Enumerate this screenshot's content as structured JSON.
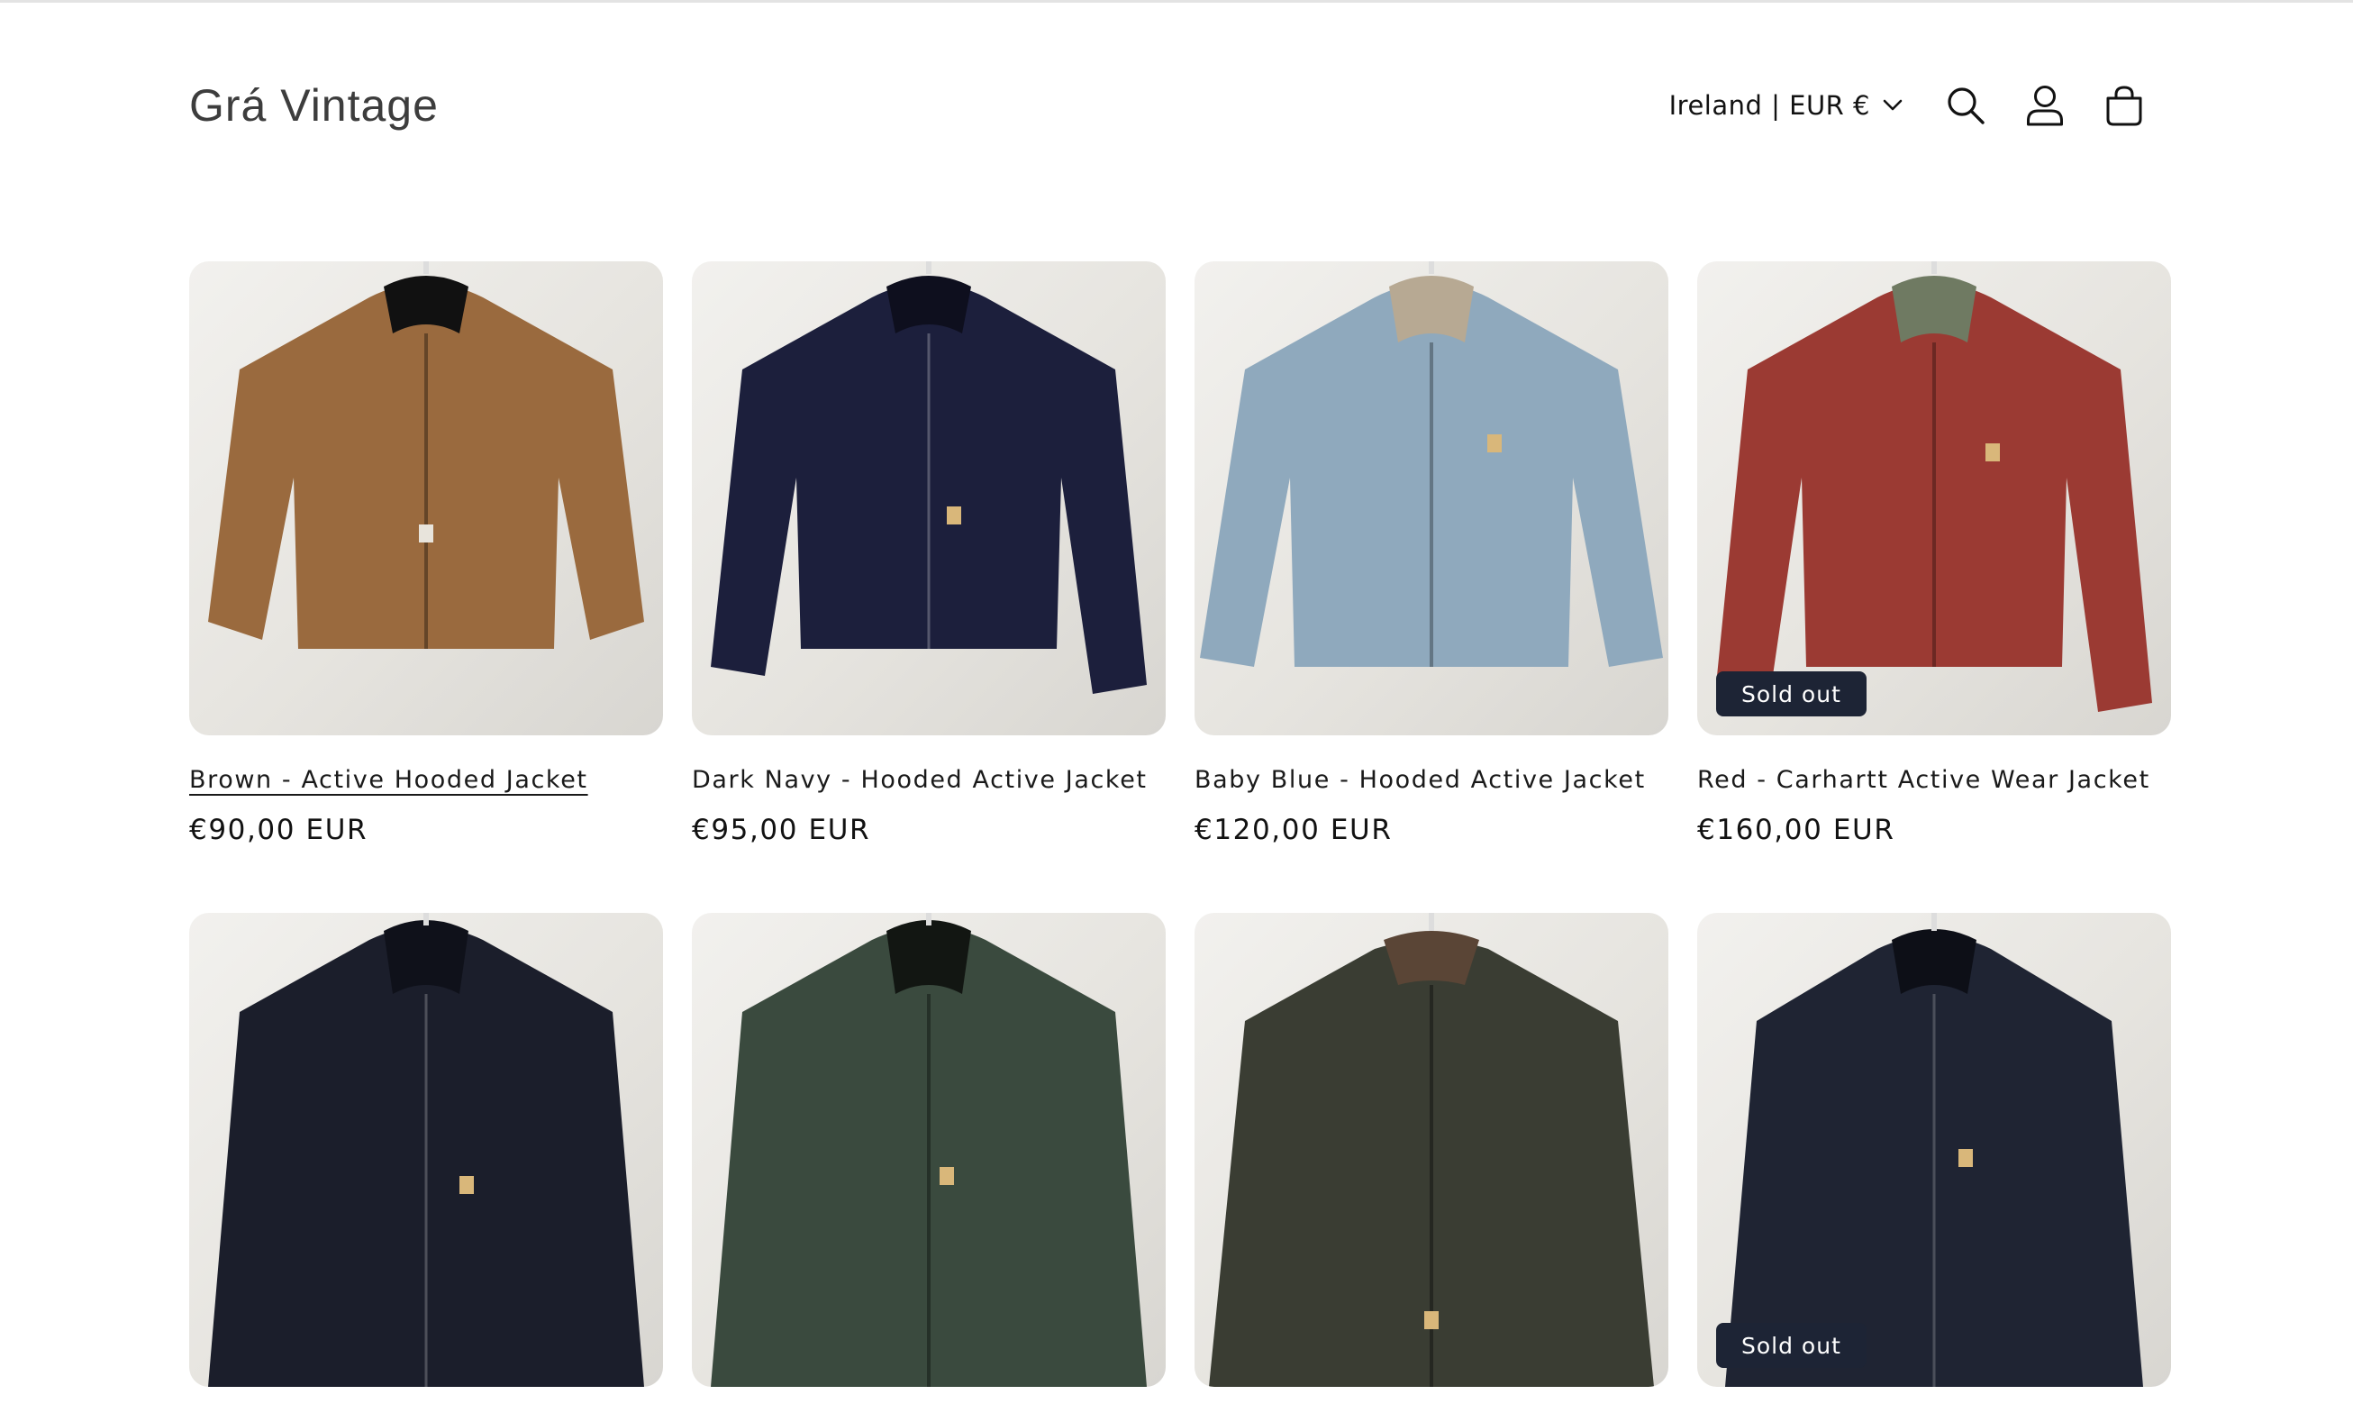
{
  "header": {
    "logo": "Grá Vintage",
    "locale_label": "Ireland | EUR €",
    "icons": [
      "search-icon",
      "account-icon",
      "cart-icon"
    ]
  },
  "products": [
    {
      "title": "Brown - Active Hooded Jacket",
      "price": "€90,00 EUR",
      "badge": "",
      "color": "#9a6a3e",
      "hovered": true
    },
    {
      "title": "Dark Navy - Hooded Active Jacket",
      "price": "€95,00 EUR",
      "badge": "",
      "color": "#1c1f3c"
    },
    {
      "title": "Baby Blue - Hooded Active Jacket",
      "price": "€120,00 EUR",
      "badge": "",
      "color": "#8fa9bd"
    },
    {
      "title": "Red - Carhartt Active Wear Jacket",
      "price": "€160,00 EUR",
      "badge": "Sold out",
      "color": "#9b3a33"
    },
    {
      "title": "",
      "price": "",
      "badge": "",
      "color": "#1b1e2b"
    },
    {
      "title": "",
      "price": "",
      "badge": "",
      "color": "#3a4a3e"
    },
    {
      "title": "",
      "price": "",
      "badge": "",
      "color": "#3a3d33"
    },
    {
      "title": "",
      "price": "",
      "badge": "Sold out",
      "color": "#1f2433"
    }
  ],
  "colors": {
    "badge_bg": "#1d2435",
    "text": "#121212",
    "logo": "#3d3d3d"
  }
}
